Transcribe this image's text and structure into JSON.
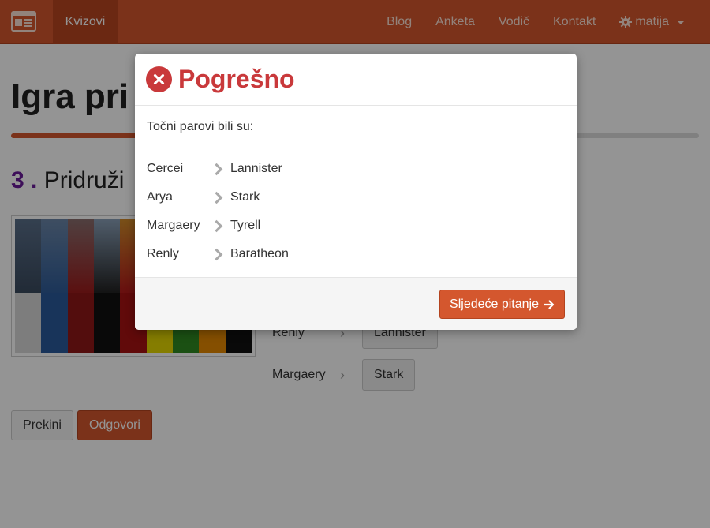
{
  "navbar": {
    "active_tab": "Kvizovi",
    "links": [
      "Blog",
      "Anketa",
      "Vodič",
      "Kontakt"
    ],
    "user": "matija"
  },
  "page": {
    "title": "Igra pri",
    "question_number": "3",
    "question_dot": ".",
    "question_text": "Pridruži",
    "matches": [
      {
        "left": "Renly",
        "right": "Lannister"
      },
      {
        "left": "Margaery",
        "right": "Stark"
      }
    ],
    "cancel_label": "Prekini",
    "answer_label": "Odgovori"
  },
  "modal": {
    "title": "Pogrešno",
    "intro": "Točni parovi bili su:",
    "pairs": [
      {
        "left": "Cercei",
        "right": "Lannister"
      },
      {
        "left": "Arya",
        "right": "Stark"
      },
      {
        "left": "Margaery",
        "right": "Tyrell"
      },
      {
        "left": "Renly",
        "right": "Baratheon"
      }
    ],
    "next_label": "Sljedeće pitanje"
  },
  "colors": {
    "brand": "#d4572e",
    "error": "#c9393b",
    "question_number": "#6a1b9a"
  }
}
